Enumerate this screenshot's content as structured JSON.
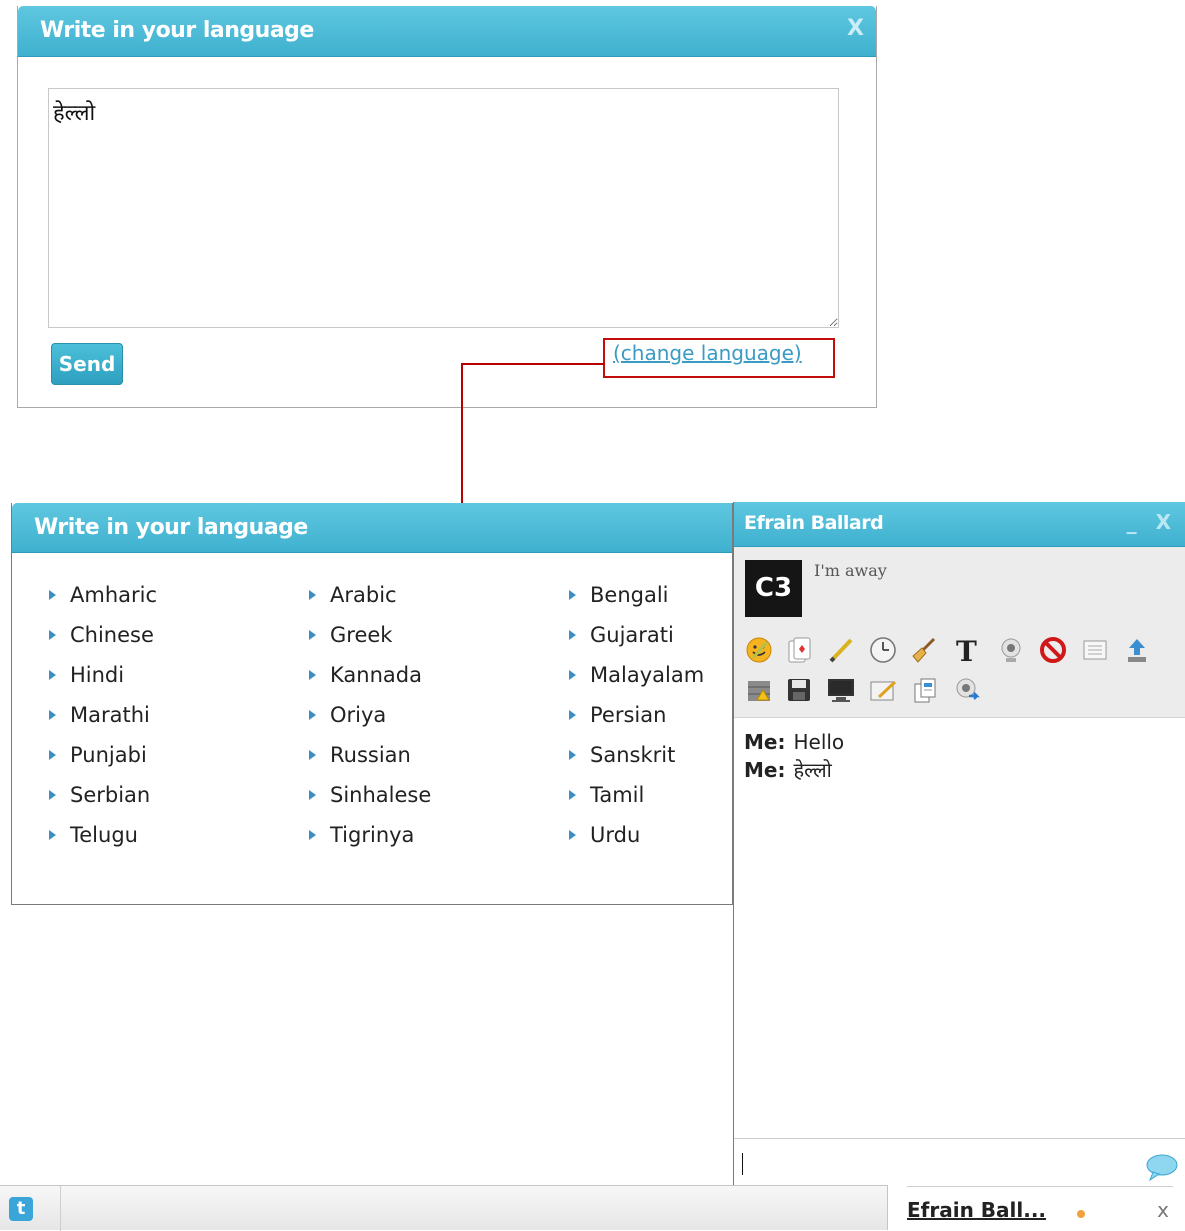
{
  "top_dialog": {
    "title": "Write in your language",
    "close": "X",
    "text_value": "हेल्लो",
    "send_label": "Send",
    "change_language": "(change language)"
  },
  "language_dialog": {
    "title": "Write in your language",
    "languages": [
      [
        "Amharic",
        "Arabic",
        "Bengali"
      ],
      [
        "Chinese",
        "Greek",
        "Gujarati"
      ],
      [
        "Hindi",
        "Kannada",
        "Malayalam"
      ],
      [
        "Marathi",
        "Oriya",
        "Persian"
      ],
      [
        "Punjabi",
        "Russian",
        "Sanskrit"
      ],
      [
        "Serbian",
        "Sinhalese",
        "Tamil"
      ],
      [
        "Telugu",
        "Tigrinya",
        "Urdu"
      ]
    ]
  },
  "chat": {
    "title": "Efrain Ballard",
    "controls": "_ X",
    "avatar_text": "C3",
    "status": "I'm away",
    "toolbar_icons": [
      "smiley-icon",
      "cards-icon",
      "pencil-icon",
      "clock-icon",
      "broom-icon",
      "text-format-icon",
      "webcam-icon",
      "block-icon",
      "list-icon",
      "upload-icon",
      "game-icon",
      "save-icon",
      "screen-share-icon",
      "whiteboard-icon",
      "copy-icon",
      "webcam-share-icon"
    ],
    "messages": [
      {
        "sender": "Me:",
        "text": "Hello"
      },
      {
        "sender": "Me:",
        "text": "हेल्लो"
      }
    ]
  },
  "bottom_bar": {
    "twitter": "t",
    "tab_name": "Efrain Ball...",
    "tab_close": "x"
  },
  "colors": {
    "header": "#43b4d2",
    "highlight": "#c30d0d",
    "link": "#3b9bc4",
    "status_dot": "#f2a23a"
  }
}
